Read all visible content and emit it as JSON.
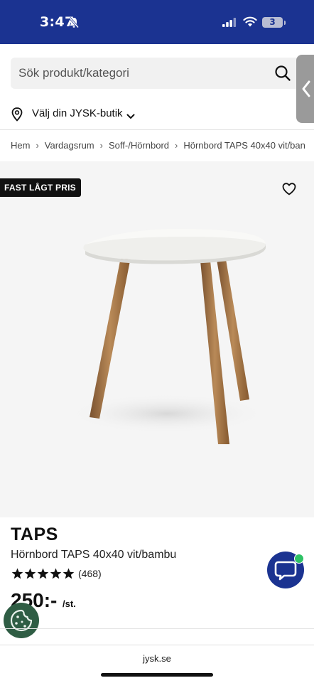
{
  "status_bar": {
    "time": "3:47",
    "battery": "3",
    "bg_color": "#1b3391"
  },
  "search": {
    "placeholder": "Sök produkt/kategori",
    "icon": "search-icon"
  },
  "store": {
    "label": "Välj din JYSK-butik",
    "icon": "location-pin-icon"
  },
  "breadcrumb": [
    "Hem",
    "Vardagsrum",
    "Soff-/Hörnbord",
    "Hörnbord TAPS 40x40 vit/ban"
  ],
  "badge": {
    "label": "FAST LÅGT PRIS"
  },
  "gallery": {
    "image": "white triangular side table with bamboo legs",
    "dot_count": 4,
    "active_index": 0
  },
  "product": {
    "brand": "TAPS",
    "name": "Hörnbord TAPS 40x40 vit/bambu",
    "rating": 5,
    "review_count": "(468)",
    "price": "250:-",
    "price_unit": "/st."
  },
  "browser": {
    "url": "jysk.se"
  },
  "colors": {
    "brand_blue": "#1b3391",
    "online_green": "#2ec265",
    "cookie_green": "#2f5d44"
  }
}
